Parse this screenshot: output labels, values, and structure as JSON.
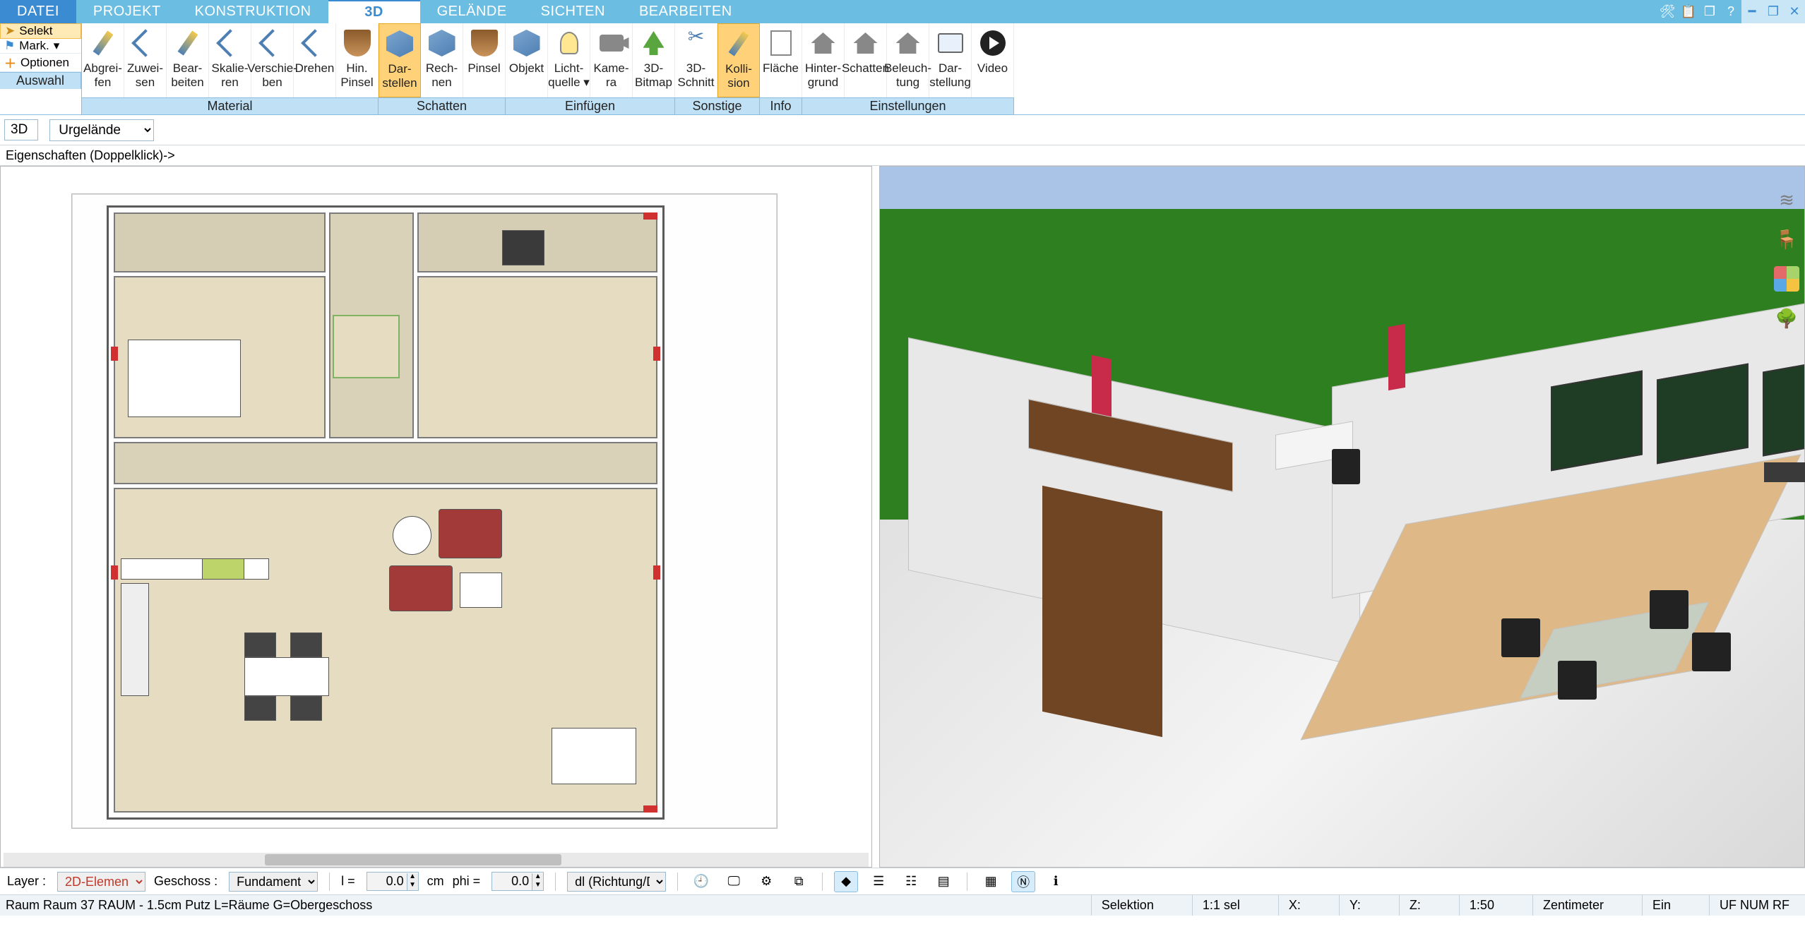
{
  "menu": {
    "tabs": [
      "DATEI",
      "PROJEKT",
      "KONSTRUKTION",
      "3D",
      "GELÄNDE",
      "SICHTEN",
      "BEARBEITEN"
    ],
    "active_index": 3
  },
  "title_icons": [
    "tools-icon",
    "clipboard-icon",
    "layers-icon",
    "help-icon",
    "minimize-icon",
    "restore-icon",
    "close-icon"
  ],
  "side_panel": {
    "select": "Selekt",
    "mark": "Mark.",
    "options": "Optionen",
    "group_label": "Auswahl"
  },
  "ribbon": {
    "groups": [
      {
        "label": "Material",
        "buttons": [
          {
            "l1": "Abgrei-",
            "l2": "fen",
            "icon": "pen"
          },
          {
            "l1": "Zuwei-",
            "l2": "sen",
            "icon": "arrow"
          },
          {
            "l1": "Bear-",
            "l2": "beiten",
            "icon": "pen"
          },
          {
            "l1": "Skalie-",
            "l2": "ren",
            "icon": "arrow"
          },
          {
            "l1": "Verschie-",
            "l2": "ben",
            "icon": "arrow"
          },
          {
            "l1": "Drehen",
            "l2": "",
            "icon": "arrow"
          },
          {
            "l1": "Hin.",
            "l2": "Pinsel",
            "icon": "brush"
          }
        ]
      },
      {
        "label": "Schatten",
        "buttons": [
          {
            "l1": "Dar-",
            "l2": "stellen",
            "icon": "cube",
            "hl": true
          },
          {
            "l1": "Rech-",
            "l2": "nen",
            "icon": "cube"
          },
          {
            "l1": "Pinsel",
            "l2": "",
            "icon": "brush"
          }
        ]
      },
      {
        "label": "Einfügen",
        "buttons": [
          {
            "l1": "Objekt",
            "l2": "",
            "icon": "cube"
          },
          {
            "l1": "Licht-",
            "l2": "quelle ▾",
            "icon": "lamp"
          },
          {
            "l1": "Kame-",
            "l2": "ra",
            "icon": "camera"
          },
          {
            "l1": "3D-",
            "l2": "Bitmap",
            "icon": "tree"
          }
        ]
      },
      {
        "label": "Sonstige",
        "buttons": [
          {
            "l1": "3D-",
            "l2": "Schnitt",
            "icon": "scissors"
          },
          {
            "l1": "Kolli-",
            "l2": "sion",
            "icon": "pen",
            "hl": true
          }
        ]
      },
      {
        "label": "Info",
        "buttons": [
          {
            "l1": "Fläche",
            "l2": "",
            "icon": "doc"
          }
        ]
      },
      {
        "label": "Einstellungen",
        "buttons": [
          {
            "l1": "Hinter-",
            "l2": "grund",
            "icon": "house"
          },
          {
            "l1": "Schatten",
            "l2": "",
            "icon": "house"
          },
          {
            "l1": "Beleuch-",
            "l2": "tung",
            "icon": "house"
          },
          {
            "l1": "Dar-",
            "l2": "stellung",
            "icon": "monitor"
          },
          {
            "l1": "Video",
            "l2": "",
            "icon": "play"
          }
        ]
      }
    ]
  },
  "subbar": {
    "mode": "3D",
    "terrain": "Urgelände"
  },
  "propbar": {
    "text": "Eigenschaften (Doppelklick)->"
  },
  "right_tools": [
    "layers-icon",
    "chair-icon",
    "palette-icon",
    "tree-icon"
  ],
  "bottom": {
    "layer_label": "Layer :",
    "layer_value": "2D-Elemen",
    "storey_label": "Geschoss :",
    "storey_value": "Fundament",
    "l_label": "l =",
    "l_value": "0.0",
    "unit": "cm",
    "phi_label": "phi =",
    "phi_value": "0.0",
    "dir": "dl (Richtung/Di",
    "icons": [
      "clock-icon",
      "screen-icon",
      "gears-icon",
      "copy-icon",
      "diamond-icon",
      "stack1-icon",
      "stack2-icon",
      "stack3-icon",
      "grid-icon",
      "north-icon",
      "info-icon"
    ]
  },
  "status": {
    "left": "Raum Raum 37 RAUM  -  1.5cm Putz L=Räume G=Obergeschoss",
    "selektion": "Selektion",
    "sel_ratio": "1:1 sel",
    "x": "X:",
    "y": "Y:",
    "z": "Z:",
    "scale": "1:50",
    "unit": "Zentimeter",
    "ein": "Ein",
    "flags": "UF NUM RF"
  }
}
